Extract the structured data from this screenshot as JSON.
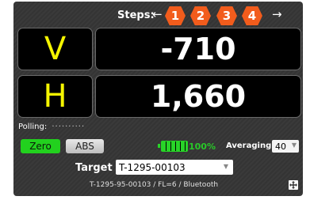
{
  "steps": {
    "label": "Steps:",
    "left_arrow": "←",
    "right_arrow": "→",
    "items": [
      "1",
      "2",
      "3",
      "4"
    ],
    "color": "#f25c1c"
  },
  "readouts": {
    "v": {
      "axis": "V",
      "value": "-710"
    },
    "h": {
      "axis": "H",
      "value": "1,660"
    },
    "axis_color": "#f5f500"
  },
  "polling": {
    "label": "Polling:",
    "indicator": "··········"
  },
  "controls": {
    "zero_label": "Zero",
    "abs_label": "ABS",
    "battery_percent": "100%",
    "averaging_label": "Averaging:",
    "averaging_value": "40"
  },
  "target": {
    "label": "Target",
    "value": "T-1295-00103"
  },
  "footer": {
    "info": "T-1295-95-00103 /  FL=6 / Bluetooth"
  },
  "icons": {
    "battery": "battery-full-icon",
    "expand": "expand-arrows-icon"
  }
}
